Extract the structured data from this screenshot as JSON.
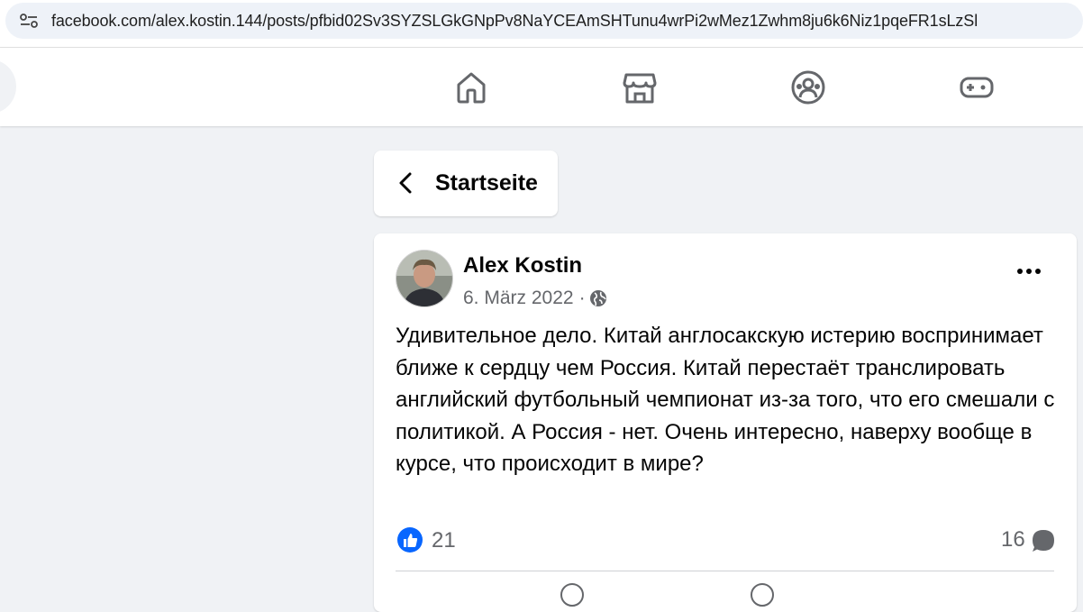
{
  "browser": {
    "url": "facebook.com/alex.kostin.144/posts/pfbid02Sv3SYZSLGkGNpPv8NaYCEAmSHTunu4wrPi2wMez1Zwhm8ju6k6Niz1pqeFR1sLzSl",
    "icons": [
      "site-info-icon"
    ]
  },
  "nav": {
    "icons": [
      "home-icon",
      "marketplace-icon",
      "groups-icon",
      "gaming-icon"
    ]
  },
  "back": {
    "label": "Startseite",
    "icon": "chevron-left-icon"
  },
  "post": {
    "author": "Alex Kostin",
    "date": "6. März 2022",
    "separator": "·",
    "audience_icon": "globe-icon",
    "text": "Удивительное дело. Китай англосакскую истерию воспринимает ближе к сердцу чем Россия. Китай перестаёт транслировать английский футбольный чемпионат из-за того, что его смешали с политикой. А Россия - нет. Очень интересно, наверху вообще в курсе, что происходит в мире?",
    "likes": "21",
    "comments": "16"
  },
  "colors": {
    "accent": "#0866ff",
    "background": "#f0f2f5",
    "secondary_text": "#65676b",
    "icon_gray": "#65676b"
  }
}
